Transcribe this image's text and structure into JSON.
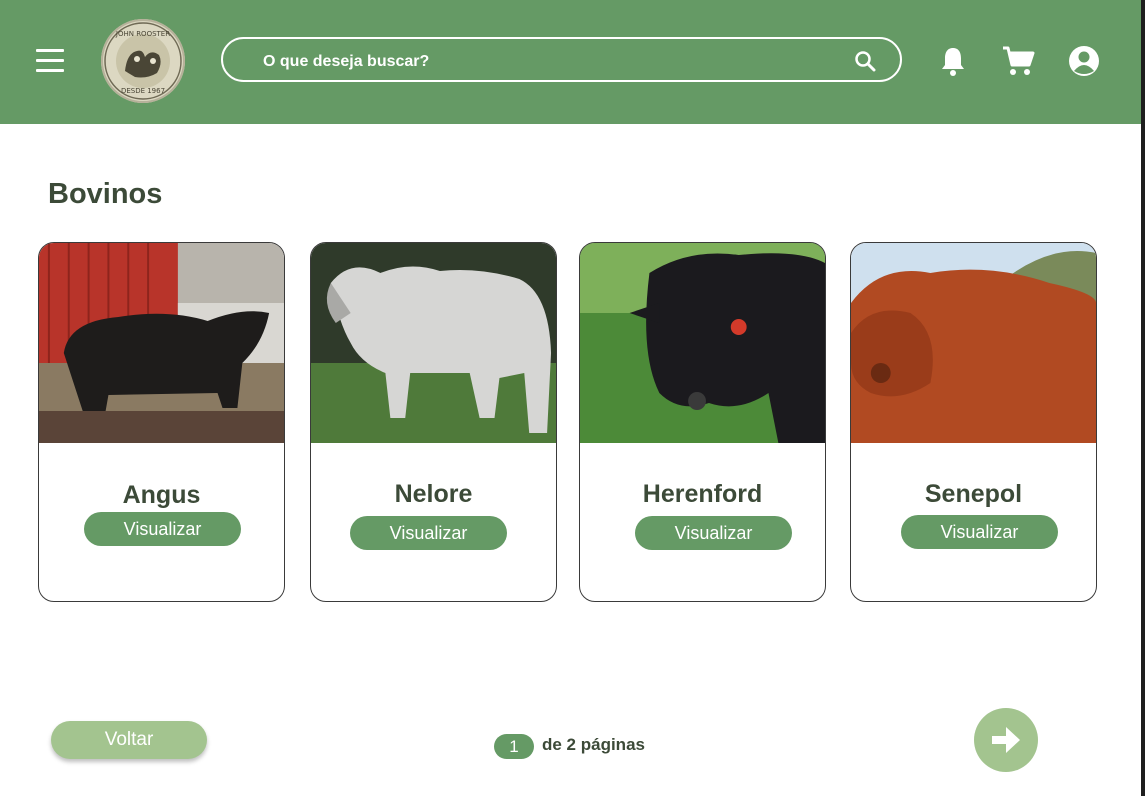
{
  "header": {
    "search_placeholder": "O que deseja buscar?",
    "logo": {
      "top_text": "JOHN ROOSTER",
      "bottom_text": "DESDE 1967"
    },
    "icons": [
      "menu-icon",
      "search-icon",
      "bell-icon",
      "cart-icon",
      "user-icon"
    ]
  },
  "section_title": "Bovinos",
  "cards": [
    {
      "name": "Angus",
      "button": "Visualizar"
    },
    {
      "name": "Nelore",
      "button": "Visualizar"
    },
    {
      "name": "Herenford",
      "button": "Visualizar"
    },
    {
      "name": "Senepol",
      "button": "Visualizar"
    }
  ],
  "footer": {
    "back_label": "Voltar",
    "current_page": "1",
    "pages_text": "de 2 páginas"
  },
  "colors": {
    "header": "#659a65",
    "primary": "#659a65",
    "light_green": "#a3c48f",
    "title_text": "#3c4a38"
  }
}
